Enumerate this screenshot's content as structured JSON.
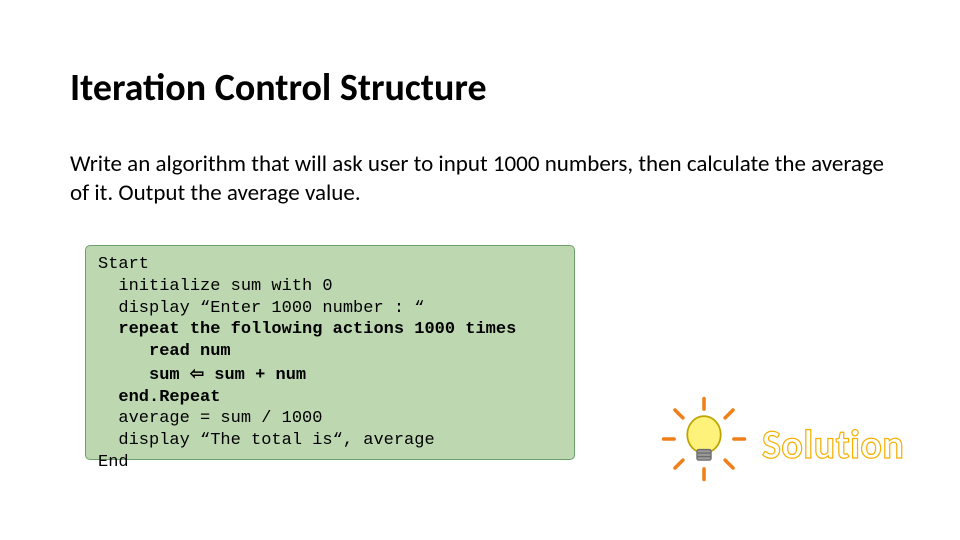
{
  "title": "Iteration Control Structure",
  "prompt": "Write an algorithm that will ask user to input 1000 numbers, then calculate the average of it. Output the average value.",
  "code": {
    "l1": "Start",
    "l2": "  initialize sum with 0",
    "l3": "  display “Enter 1000 number : “",
    "l4": "  repeat the following actions 1000 times",
    "l5": "     read num",
    "l6a": "     sum ",
    "l6arrow": "⇦",
    "l6b": " sum + num",
    "l7": "  end.Repeat",
    "l8": "  average = sum / 1000",
    "l9": "  display “The total is“, average",
    "l10": "End"
  },
  "label": "Solution",
  "icons": {
    "bulb": "lightbulb-idea-icon"
  }
}
